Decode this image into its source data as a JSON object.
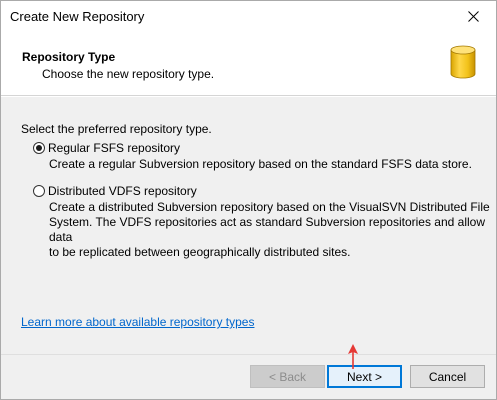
{
  "window": {
    "title": "Create New Repository"
  },
  "header": {
    "title": "Repository Type",
    "subtitle": "Choose the new repository type."
  },
  "content": {
    "prompt": "Select the preferred repository type.",
    "options": [
      {
        "label": "Regular FSFS repository",
        "selected": true,
        "description": "Create a regular Subversion repository based on the standard FSFS data store."
      },
      {
        "label": "Distributed VDFS repository",
        "selected": false,
        "description_lines": [
          "Create a distributed Subversion repository based on the VisualSVN Distributed File",
          "System. The VDFS repositories act as standard Subversion repositories and allow data",
          "to be replicated between geographically distributed sites."
        ]
      }
    ],
    "learn_more_link": "Learn more about available repository types"
  },
  "footer": {
    "back_label": "< Back",
    "next_label": "Next >",
    "cancel_label": "Cancel"
  },
  "colors": {
    "link": "#0066cc",
    "accent": "#0078d7",
    "db_icon": "#f5c518",
    "annotation_arrow": "#e53935"
  },
  "icons": {
    "close": "close-icon",
    "header": "database-icon",
    "annotation": "red-arrow-annotation"
  }
}
